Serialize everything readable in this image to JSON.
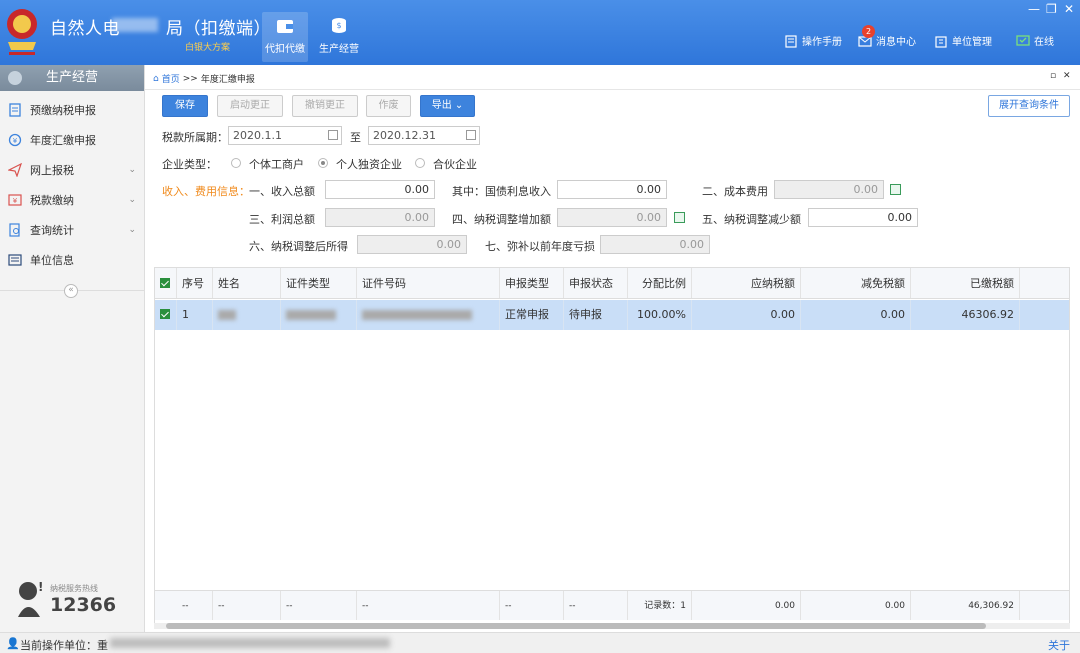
{
  "header": {
    "app_title_left": "自然人电",
    "app_title_right": "局（扣缴端）",
    "subtitle": "白银大方案",
    "nav": [
      {
        "label": "代扣代缴",
        "icon": "wallet-icon",
        "active": true
      },
      {
        "label": "生产经营",
        "icon": "coins-icon",
        "active": false
      }
    ],
    "links": {
      "manual": "操作手册",
      "messages": "消息中心",
      "message_count": "2",
      "unit_mgmt": "单位管理",
      "online": "在线"
    },
    "brand_color": "#2f76da"
  },
  "sidebar": {
    "title": "生产经营",
    "items": [
      {
        "label": "预缴纳税申报",
        "icon": "form-icon"
      },
      {
        "label": "年度汇缴申报",
        "icon": "yuan-circle-icon"
      },
      {
        "label": "网上报税",
        "icon": "send-icon",
        "has_sub": true
      },
      {
        "label": "税款缴纳",
        "icon": "tax-pay-icon",
        "has_sub": true
      },
      {
        "label": "查询统计",
        "icon": "search-doc-icon",
        "has_sub": true
      },
      {
        "label": "单位信息",
        "icon": "list-icon",
        "has_sub": false
      }
    ],
    "collapse": "«",
    "hotline_label": "纳税服务热线",
    "hotline_number": "12366"
  },
  "breadcrumb": {
    "home": "首页",
    "sep": ">>",
    "current": "年度汇缴申报"
  },
  "toolbar": {
    "save": "保存",
    "start_correct": "启动更正",
    "cancel_correct": "撤销更正",
    "void": "作废",
    "export": "导出",
    "expand_query": "展开查询条件"
  },
  "form": {
    "period_label": "税款所属期：",
    "period_from": "2020.1.1",
    "period_to_label": "至",
    "period_to": "2020.12.31",
    "enterprise_type_label": "企业类型：",
    "enterprise_types": [
      "个体工商户",
      "个人独资企业",
      "合伙企业"
    ],
    "enterprise_type_selected": "个人独资企业",
    "income_info_label": "收入、费用信息：",
    "fields": {
      "total_income_label": "一、收入总额",
      "total_income": "0.00",
      "bond_interest_label": "其中：国债利息收入",
      "bond_interest": "0.00",
      "cost_label": "二、成本费用",
      "cost": "0.00",
      "profit_label": "三、利润总额",
      "profit": "0.00",
      "increase_label": "四、纳税调整增加额",
      "increase": "0.00",
      "decrease_label": "五、纳税调整减少额",
      "decrease": "0.00",
      "adjusted_label": "六、纳税调整后所得",
      "adjusted": "0.00",
      "loss_label": "七、弥补以前年度亏损",
      "loss": "0.00"
    }
  },
  "table": {
    "columns": [
      "序号",
      "姓名",
      "证件类型",
      "证件号码",
      "申报类型",
      "申报状态",
      "分配比例",
      "应纳税额",
      "减免税额",
      "已缴税额"
    ],
    "rows": [
      {
        "seq": "1",
        "decl_type": "正常申报",
        "decl_status": "待申报",
        "ratio": "100.00%",
        "payable": "0.00",
        "relief": "0.00",
        "paid": "46306.92"
      }
    ],
    "footer": {
      "dash": "--",
      "record_count_label": "记录数：1",
      "payable": "0.00",
      "relief": "0.00",
      "paid": "46,306.92"
    }
  },
  "status_bar": {
    "current_unit": "当前操作单位：重",
    "about": "关于"
  }
}
